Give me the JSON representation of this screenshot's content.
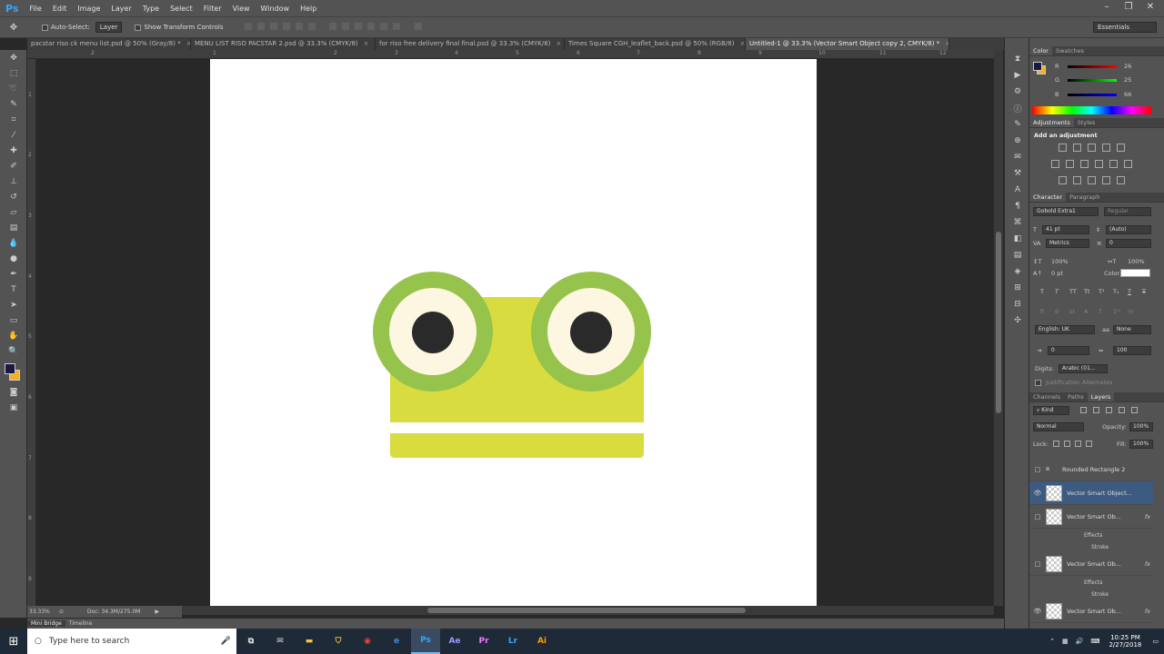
{
  "app": {
    "logo": "Ps",
    "menus": [
      "File",
      "Edit",
      "Image",
      "Layer",
      "Type",
      "Select",
      "Filter",
      "View",
      "Window",
      "Help"
    ]
  },
  "options": {
    "auto_select_label": "Auto-Select:",
    "auto_select_value": "Layer",
    "show_transform_label": "Show Transform Controls",
    "workspace": "Essentials"
  },
  "tabs": [
    {
      "label": "pacstar riso ck menu list.psd @ 50% (Gray/8) *"
    },
    {
      "label": "MENU LIST RISO PACSTAR 2.psd @ 33.3% (CMYK/8)"
    },
    {
      "label": "for riso free delivery final final.psd @ 33.3% (CMYK/8)"
    },
    {
      "label": "Times Square CGH_leaflet_back.psd @ 50% (RGB/8)"
    },
    {
      "label": "Untitled-1 @ 33.3% (Vector Smart Object copy 2, CMYK/8) *"
    }
  ],
  "ruler_top": [
    "2",
    "1",
    "2",
    "3",
    "4",
    "5",
    "6",
    "7",
    "8",
    "9",
    "10",
    "11",
    "12"
  ],
  "ruler_left": [
    "1",
    "2",
    "3",
    "4",
    "5",
    "6",
    "7",
    "8",
    "9"
  ],
  "status": {
    "zoom": "33.33%",
    "doc": "Doc: 34.3M/275.0M"
  },
  "bottom_tabs": [
    "Mini Bridge",
    "Timeline"
  ],
  "colors": {
    "foreground": "#1a1942",
    "background": "#f0b02a",
    "frog_body": "#d8dc3f",
    "frog_eye_ring": "#96c34c",
    "frog_eye_white": "#fdf6e0",
    "frog_pupil": "#2a2a2a"
  },
  "color_panel": {
    "tabs": [
      "Color",
      "Swatches"
    ],
    "r_label": "R",
    "r_value": "26",
    "g_label": "G",
    "g_value": "25",
    "b_label": "B",
    "b_value": "66"
  },
  "adjustments": {
    "tabs": [
      "Adjustments",
      "Styles"
    ],
    "title": "Add an adjustment"
  },
  "character": {
    "tabs": [
      "Character",
      "Paragraph"
    ],
    "font": "Gobold Extra1",
    "style": "Regular",
    "size": "41 pt",
    "leading": "(Auto)",
    "kerning": "Metrics",
    "tracking": "0",
    "vscale": "100%",
    "hscale": "100%",
    "baseline": "0 pt",
    "color_label": "Color:",
    "language": "English: UK",
    "aa": "None",
    "val1": "0",
    "val2": "100",
    "digits_label": "Digits:",
    "digits_value": "Arabic (01...",
    "justification": "Justification Alternates"
  },
  "layers_panel": {
    "tabs": [
      "Channels",
      "Paths",
      "Layers"
    ],
    "kind": "Kind",
    "blend": "Normal",
    "opacity_label": "Opacity:",
    "opacity": "100%",
    "lock_label": "Lock:",
    "fill_label": "Fill:",
    "fill": "100%",
    "layers": [
      {
        "name": "Rounded Rectangle 2"
      },
      {
        "name": "Vector Smart Object..."
      },
      {
        "name": "Vector Smart Ob...",
        "effects": "Effects",
        "stroke": "Stroke"
      },
      {
        "name": "Vector Smart Ob...",
        "effects": "Effects",
        "stroke": "Stroke"
      },
      {
        "name": "Vector Smart Ob..."
      }
    ]
  },
  "taskbar": {
    "search_placeholder": "Type here to search",
    "apps": [
      "Ae",
      "Pr",
      "Lr",
      "Ai"
    ],
    "time": "10:25 PM",
    "date": "2/27/2018"
  }
}
